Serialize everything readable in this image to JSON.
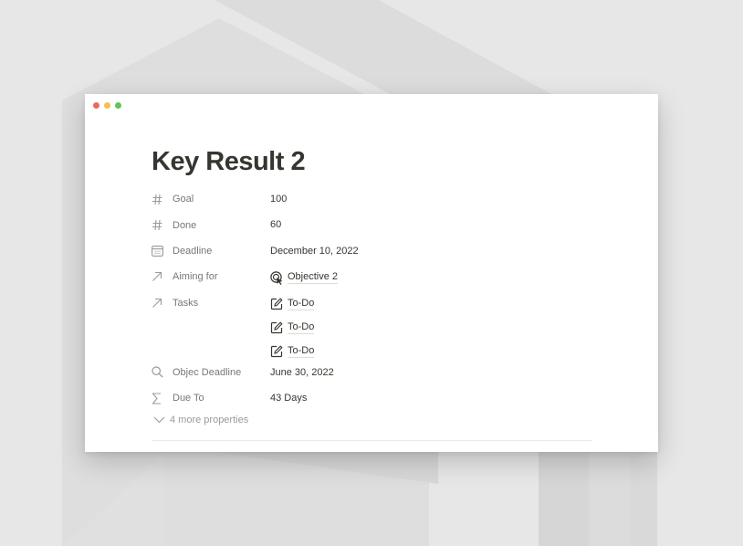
{
  "page": {
    "title": "Key Result 2",
    "properties": [
      {
        "name": "Goal",
        "icon": "number-icon",
        "value": "100"
      },
      {
        "name": "Done",
        "icon": "number-icon",
        "value": "60"
      },
      {
        "name": "Deadline",
        "icon": "calendar-icon",
        "value": "December 10, 2022"
      },
      {
        "name": "Aiming for",
        "icon": "relation-arrow-icon",
        "value": "Objective 2",
        "value_icon": "target-icon"
      },
      {
        "name": "Tasks",
        "icon": "relation-arrow-icon",
        "values": [
          "To-Do",
          "To-Do",
          "To-Do"
        ],
        "value_icon": "edit-icon"
      },
      {
        "name": "Objec Deadline",
        "icon": "search-icon",
        "value": "June 30, 2022"
      },
      {
        "name": "Due To",
        "icon": "sigma-icon",
        "value": "43 Days"
      }
    ],
    "more_properties_label": "4 more properties"
  },
  "colors": {
    "background": "#e7e7e7",
    "window": "#ffffff",
    "title_text": "#37352f",
    "label_text": "#787774",
    "close": "#ec6a5f",
    "minimize": "#f4bf4f",
    "maximize": "#61c554"
  }
}
